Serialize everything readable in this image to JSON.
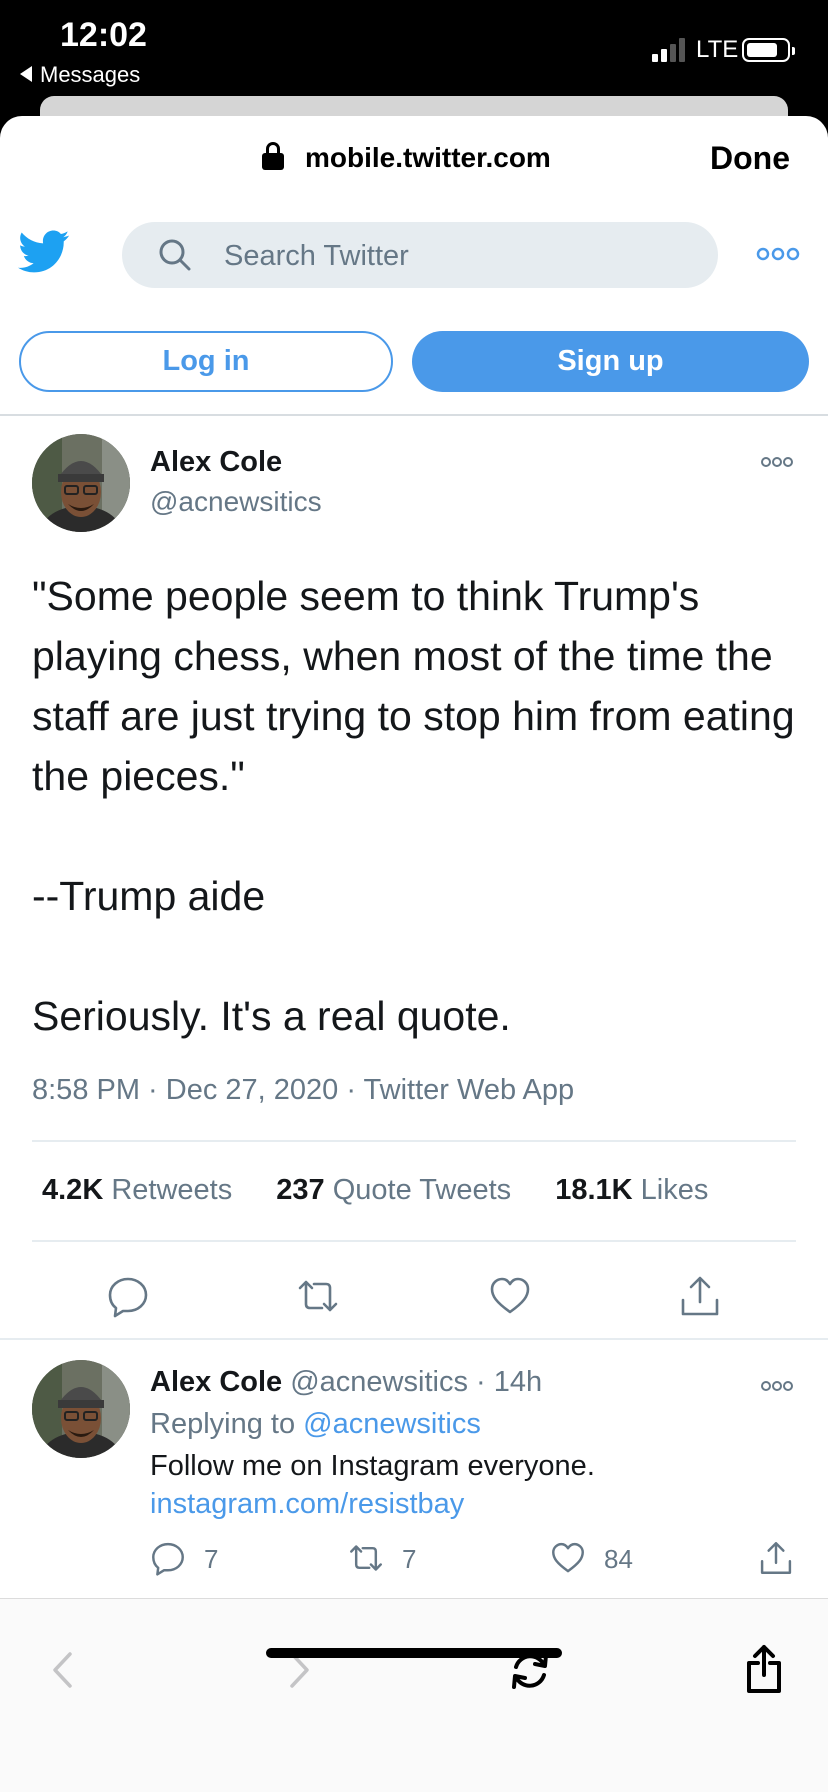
{
  "status_bar": {
    "time": "12:02",
    "back_label": "Messages",
    "network": "LTE"
  },
  "browser": {
    "url": "mobile.twitter.com",
    "done_label": "Done"
  },
  "header": {
    "search_placeholder": "Search Twitter",
    "login_label": "Log in",
    "signup_label": "Sign up"
  },
  "tweet": {
    "author_name": "Alex Cole",
    "author_handle": "@acnewsitics",
    "text": "\"Some people seem to think Trump's playing chess, when most of the time the staff are just trying to stop him from eating the pieces.\"\n\n--Trump aide\n\nSeriously. It's a real quote.",
    "meta": "8:58 PM · Dec 27, 2020 · Twitter Web App",
    "stats": {
      "retweets_count": "4.2K",
      "retweets_label": "Retweets",
      "quotes_count": "237",
      "quotes_label": "Quote Tweets",
      "likes_count": "18.1K",
      "likes_label": "Likes"
    }
  },
  "reply": {
    "author_name": "Alex Cole",
    "author_handle": "@acnewsitics",
    "time": "14h",
    "replying_prefix": "Replying to",
    "replying_handle": "@acnewsitics",
    "text": "Follow me on Instagram everyone.",
    "link": "instagram.com/resistbay",
    "reply_count": "7",
    "retweet_count": "7",
    "like_count": "84"
  },
  "colors": {
    "twitter_blue": "#4a99e9",
    "secondary_text": "#657786",
    "search_bg": "#e6ecf0"
  }
}
